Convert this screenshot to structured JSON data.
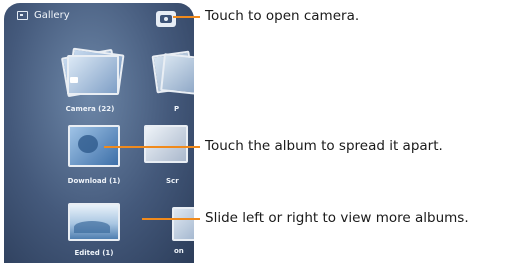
{
  "phone": {
    "app_title": "Gallery",
    "albums": [
      {
        "label": "Camera (22)"
      },
      {
        "label": "Download (1)"
      },
      {
        "label": "Edited (1)"
      }
    ],
    "partial_labels": [
      "P",
      "Scr",
      "on"
    ]
  },
  "callouts": [
    "Touch to open camera.",
    "Touch the album to spread it apart.",
    "Slide left or right to view more albums."
  ],
  "colors": {
    "callout_line": "#f08a1c",
    "screen_background": "#44597b",
    "label_text": "#eef3f9"
  }
}
